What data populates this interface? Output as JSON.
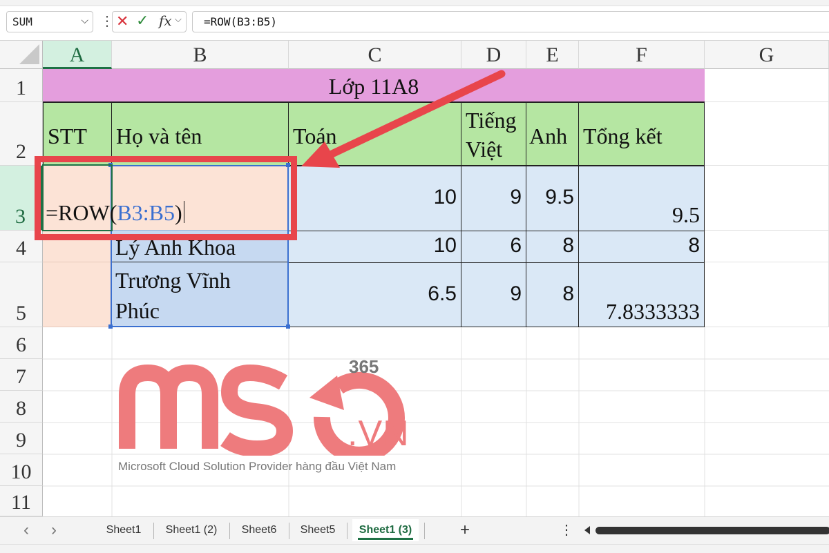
{
  "formula_bar": {
    "name_box": "SUM",
    "name_box_chevron": "⌵",
    "dots": "⋮",
    "cancel": "✕",
    "enter": "✓",
    "fx": "fx",
    "fx_chevron": "⌵",
    "formula": "=ROW(B3:B5)"
  },
  "columns": [
    "A",
    "B",
    "C",
    "D",
    "E",
    "F",
    "G"
  ],
  "rows": [
    "1",
    "2",
    "3",
    "4",
    "5",
    "6",
    "7",
    "8",
    "9",
    "10",
    "11"
  ],
  "sheet": {
    "title": "Lớp 11A8",
    "headers": {
      "stt": "STT",
      "name": "Họ và tên",
      "math": "Toán",
      "viet_line1": "Tiếng",
      "viet_line2": "Việt",
      "english": "Anh",
      "total": "Tổng kết"
    },
    "edit": {
      "prefix": "=ROW(",
      "ref": "B3:B5",
      "suffix": ")"
    },
    "row3": {
      "math": "10",
      "viet": "9",
      "english": "9.5",
      "total": "9.5"
    },
    "row4": {
      "name": "Lý Anh Khoa",
      "math": "10",
      "viet": "6",
      "english": "8",
      "total": "8"
    },
    "row5": {
      "name_line1": "Trương Vĩnh",
      "name_line2": "Phúc",
      "math": "6.5",
      "viet": "9",
      "english": "8",
      "total": "7.8333333"
    }
  },
  "watermark": {
    "superscript": "365",
    "brand": "MSO",
    "domain": ".VN",
    "tagline": "Microsoft Cloud Solution Provider hàng đầu Việt Nam"
  },
  "tabs": {
    "prev": "‹",
    "next": "›",
    "items": [
      "Sheet1",
      "Sheet1 (2)",
      "Sheet6",
      "Sheet5",
      "Sheet1 (3)"
    ],
    "active": "Sheet1 (3)",
    "add": "+",
    "more": "⋮"
  },
  "colors": {
    "title_fill": "#e49edd",
    "header_fill": "#b5e6a2",
    "data_fill": "#dae8f6",
    "edit_fill": "#fce3d6",
    "annotation": "#e8454b",
    "selection_green": "#1e7145"
  }
}
